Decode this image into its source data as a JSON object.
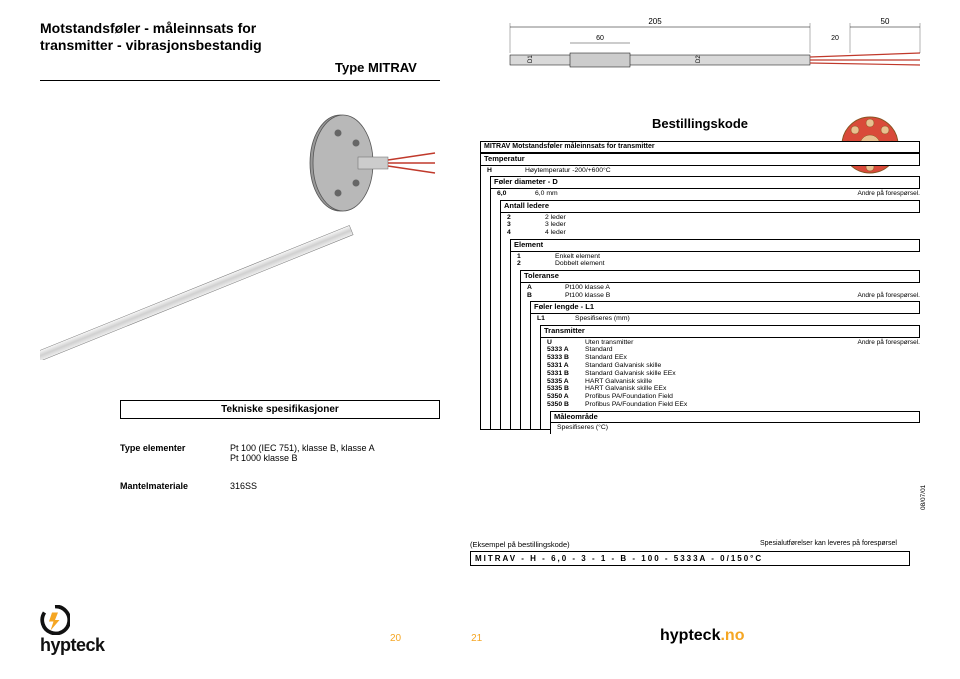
{
  "header": {
    "title_line1": "Motstandsføler - måleinnsats for",
    "title_line2": "transmitter - vibrasjonsbestandig",
    "type": "Type MITRAV"
  },
  "top_dims": {
    "L1_lbl": "205",
    "r_lbl": "50",
    "seg60": "60",
    "seg20": "20",
    "D1": "D1",
    "D2": "D2"
  },
  "ordering": {
    "heading": "Bestillingskode",
    "product": "MITRAV Motstandsføler måleinnsats for transmitter",
    "temp_hdr": "Temperatur",
    "temp_item_code": "H",
    "temp_item_desc": "Høytemperatur -200/+600°C",
    "diam_hdr": "Føler diameter - D",
    "diam_code": "6,0",
    "diam_desc": "6,0 mm",
    "diam_note": "Andre på forespørsel.",
    "leads_hdr": "Antall ledere",
    "leads": [
      {
        "code": "2",
        "desc": "2 leder"
      },
      {
        "code": "3",
        "desc": "3 leder"
      },
      {
        "code": "4",
        "desc": "4 leder"
      }
    ],
    "elem_hdr": "Element",
    "elem": [
      {
        "code": "1",
        "desc": "Enkelt element"
      },
      {
        "code": "2",
        "desc": "Dobbelt element"
      }
    ],
    "tol_hdr": "Toleranse",
    "tol": [
      {
        "code": "A",
        "desc": "Pt100 klasse A"
      },
      {
        "code": "B",
        "desc": "Pt100 klasse B"
      }
    ],
    "tol_note": "Andre på forespørsel.",
    "len_hdr": "Føler lengde - L1",
    "len_item_code": "L1",
    "len_item_desc": "Spesifiseres (mm)",
    "tx_hdr": "Transmitter",
    "tx_note": "Andre på forespørsel.",
    "tx": [
      {
        "code": "U",
        "desc": "Uten transmitter"
      },
      {
        "code": "5333 A",
        "desc": "Standard"
      },
      {
        "code": "5333 B",
        "desc": "Standard EEx"
      },
      {
        "code": "5331 A",
        "desc": "Standard Galvanisk skille"
      },
      {
        "code": "5331 B",
        "desc": "Standard Galvanisk skille EEx"
      },
      {
        "code": "5335 A",
        "desc": "HART Galvanisk skille"
      },
      {
        "code": "5335 B",
        "desc": "HART Galvanisk skille EEx"
      },
      {
        "code": "5350 A",
        "desc": "Profibus PA/Foundation Field"
      },
      {
        "code": "5350 B",
        "desc": "Profibus PA/Foundation Field EEx"
      }
    ],
    "range_hdr": "Måleområde",
    "range_desc": "Spesifiseres (°C)"
  },
  "techspec": {
    "heading": "Tekniske spesifikasjoner",
    "rows": [
      {
        "label": "Type elementer",
        "val_l1": "Pt 100 (IEC 751), klasse B, klasse A",
        "val_l2": "Pt 1000 klasse B"
      },
      {
        "label": "Mantelmateriale",
        "val_l1": "316SS",
        "val_l2": ""
      }
    ]
  },
  "example": {
    "title": "(Eksempel på bestillingskode)",
    "code": "MITRAV - H - 6,0 - 3 - 1 - B - 100 - 5333A - 0/150°C",
    "special_note": "Spesialutførelser kan leveres på forespørsel",
    "date": "08/07/01"
  },
  "footer": {
    "brand": "hypteck",
    "page_left": "20",
    "page_right": "21",
    "site_main": "hypteck",
    "site_suffix": ".no"
  }
}
